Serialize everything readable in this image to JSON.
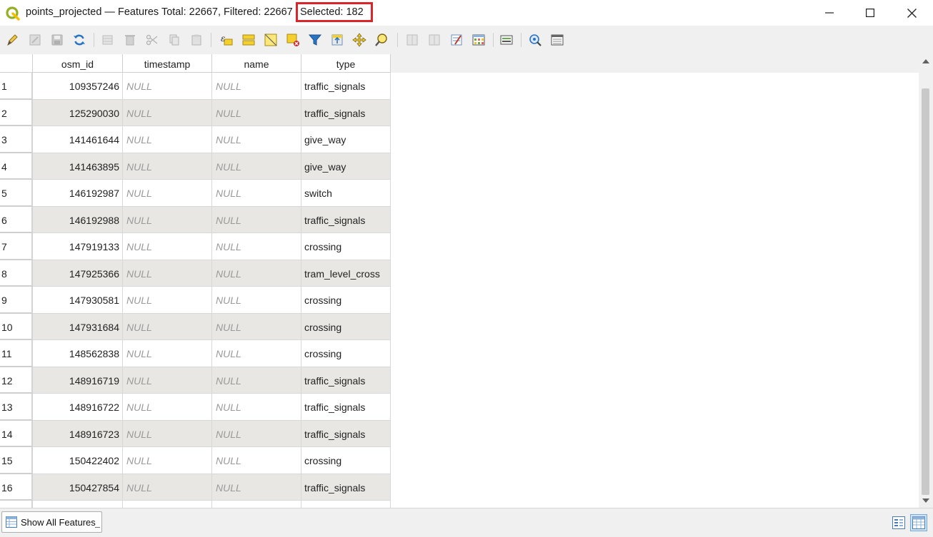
{
  "window": {
    "title": "points_projected — Features Total: 22667, Filtered: 22667",
    "selected": "Selected: 182"
  },
  "toolbar": {
    "icons": [
      "pencil-icon",
      "multi-edit-icon",
      "save-icon",
      "reload-icon",
      "add-feature-icon",
      "delete-icon",
      "cut-icon",
      "copy-icon",
      "paste-icon",
      "expression-select-icon",
      "select-all-icon",
      "invert-selection-icon",
      "deselect-icon",
      "filter-icon",
      "move-selection-top-icon",
      "pan-to-selection-icon",
      "zoom-to-selection-icon",
      "new-field-icon",
      "delete-field-icon",
      "field-calculator-icon",
      "conditional-format-icon",
      "actions-icon",
      "dock-icon",
      "organize-columns-icon"
    ]
  },
  "table": {
    "columns": [
      "osm_id",
      "timestamp",
      "name",
      "type"
    ],
    "rows": [
      {
        "n": "1",
        "osm_id": "109357246",
        "timestamp": "NULL",
        "name": "NULL",
        "type": "traffic_signals"
      },
      {
        "n": "2",
        "osm_id": "125290030",
        "timestamp": "NULL",
        "name": "NULL",
        "type": "traffic_signals"
      },
      {
        "n": "3",
        "osm_id": "141461644",
        "timestamp": "NULL",
        "name": "NULL",
        "type": "give_way"
      },
      {
        "n": "4",
        "osm_id": "141463895",
        "timestamp": "NULL",
        "name": "NULL",
        "type": "give_way"
      },
      {
        "n": "5",
        "osm_id": "146192987",
        "timestamp": "NULL",
        "name": "NULL",
        "type": "switch"
      },
      {
        "n": "6",
        "osm_id": "146192988",
        "timestamp": "NULL",
        "name": "NULL",
        "type": "traffic_signals"
      },
      {
        "n": "7",
        "osm_id": "147919133",
        "timestamp": "NULL",
        "name": "NULL",
        "type": "crossing"
      },
      {
        "n": "8",
        "osm_id": "147925366",
        "timestamp": "NULL",
        "name": "NULL",
        "type": "tram_level_cross"
      },
      {
        "n": "9",
        "osm_id": "147930581",
        "timestamp": "NULL",
        "name": "NULL",
        "type": "crossing"
      },
      {
        "n": "10",
        "osm_id": "147931684",
        "timestamp": "NULL",
        "name": "NULL",
        "type": "crossing"
      },
      {
        "n": "11",
        "osm_id": "148562838",
        "timestamp": "NULL",
        "name": "NULL",
        "type": "crossing"
      },
      {
        "n": "12",
        "osm_id": "148916719",
        "timestamp": "NULL",
        "name": "NULL",
        "type": "traffic_signals"
      },
      {
        "n": "13",
        "osm_id": "148916722",
        "timestamp": "NULL",
        "name": "NULL",
        "type": "traffic_signals"
      },
      {
        "n": "14",
        "osm_id": "148916723",
        "timestamp": "NULL",
        "name": "NULL",
        "type": "traffic_signals"
      },
      {
        "n": "15",
        "osm_id": "150422402",
        "timestamp": "NULL",
        "name": "NULL",
        "type": "crossing"
      },
      {
        "n": "16",
        "osm_id": "150427854",
        "timestamp": "NULL",
        "name": "NULL",
        "type": "traffic_signals"
      }
    ]
  },
  "bottom": {
    "filter_label": "Show All Features"
  },
  "colors": {
    "highlight_box": "#d9262a",
    "alt_row": "#e9e7e3",
    "null_text": "#9a9a9a"
  }
}
